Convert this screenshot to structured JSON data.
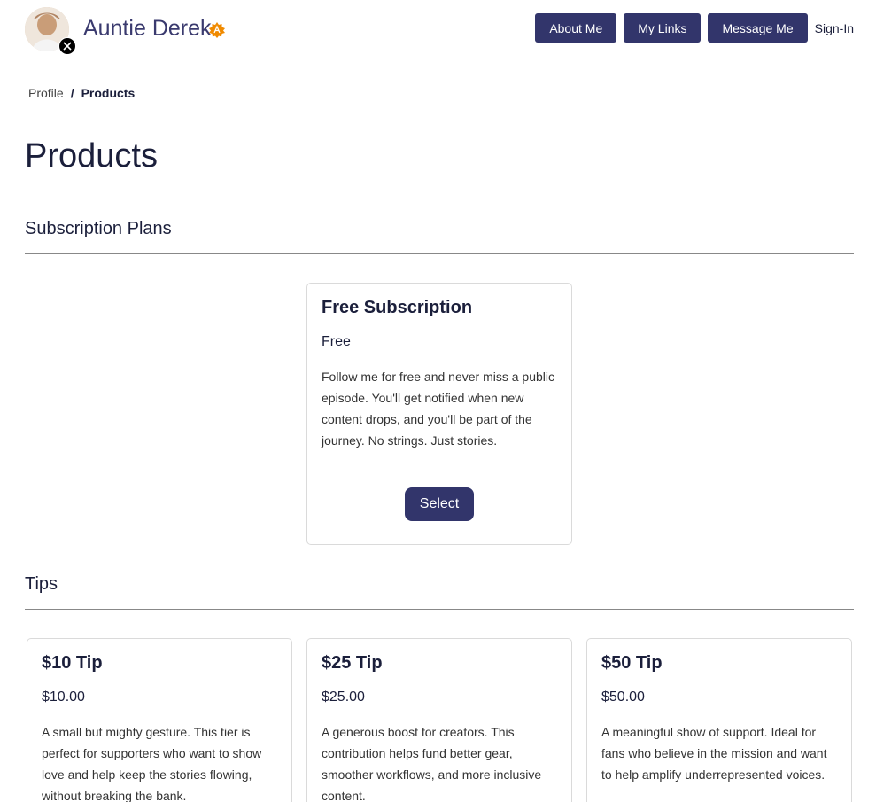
{
  "header": {
    "name": "Auntie Derek",
    "nav": {
      "about": "About Me",
      "links": "My Links",
      "message": "Message Me",
      "signin": "Sign-In"
    }
  },
  "breadcrumb": {
    "profile": "Profile",
    "separator": "/",
    "current": "Products"
  },
  "page": {
    "title": "Products"
  },
  "subscriptions": {
    "section_title": "Subscription Plans",
    "plans": [
      {
        "title": "Free Subscription",
        "price": "Free",
        "description": "Follow me for free and never miss a public episode. You'll get notified when new content drops, and you'll be part of the journey. No strings. Just stories.",
        "button": "Select"
      }
    ]
  },
  "tips": {
    "section_title": "Tips",
    "items": [
      {
        "title": "$10 Tip",
        "price": "$10.00",
        "description": "A small but mighty gesture. This tier is perfect for supporters who want to show love and help keep the stories flowing, without breaking the bank."
      },
      {
        "title": "$25 Tip",
        "price": "$25.00",
        "description": "A generous boost for creators. This contribution helps fund better gear, smoother workflows, and more inclusive content."
      },
      {
        "title": "$50 Tip",
        "price": "$50.00",
        "description": "A meaningful show of support. Ideal for fans who believe in the mission and want to help amplify underrepresented voices."
      }
    ]
  },
  "colors": {
    "accent": "#32356b",
    "text": "#1b1f3b",
    "verified_badge": "#f08a00"
  },
  "icons": {
    "verified": "verified-badge-icon",
    "social": "x-logo-icon"
  }
}
